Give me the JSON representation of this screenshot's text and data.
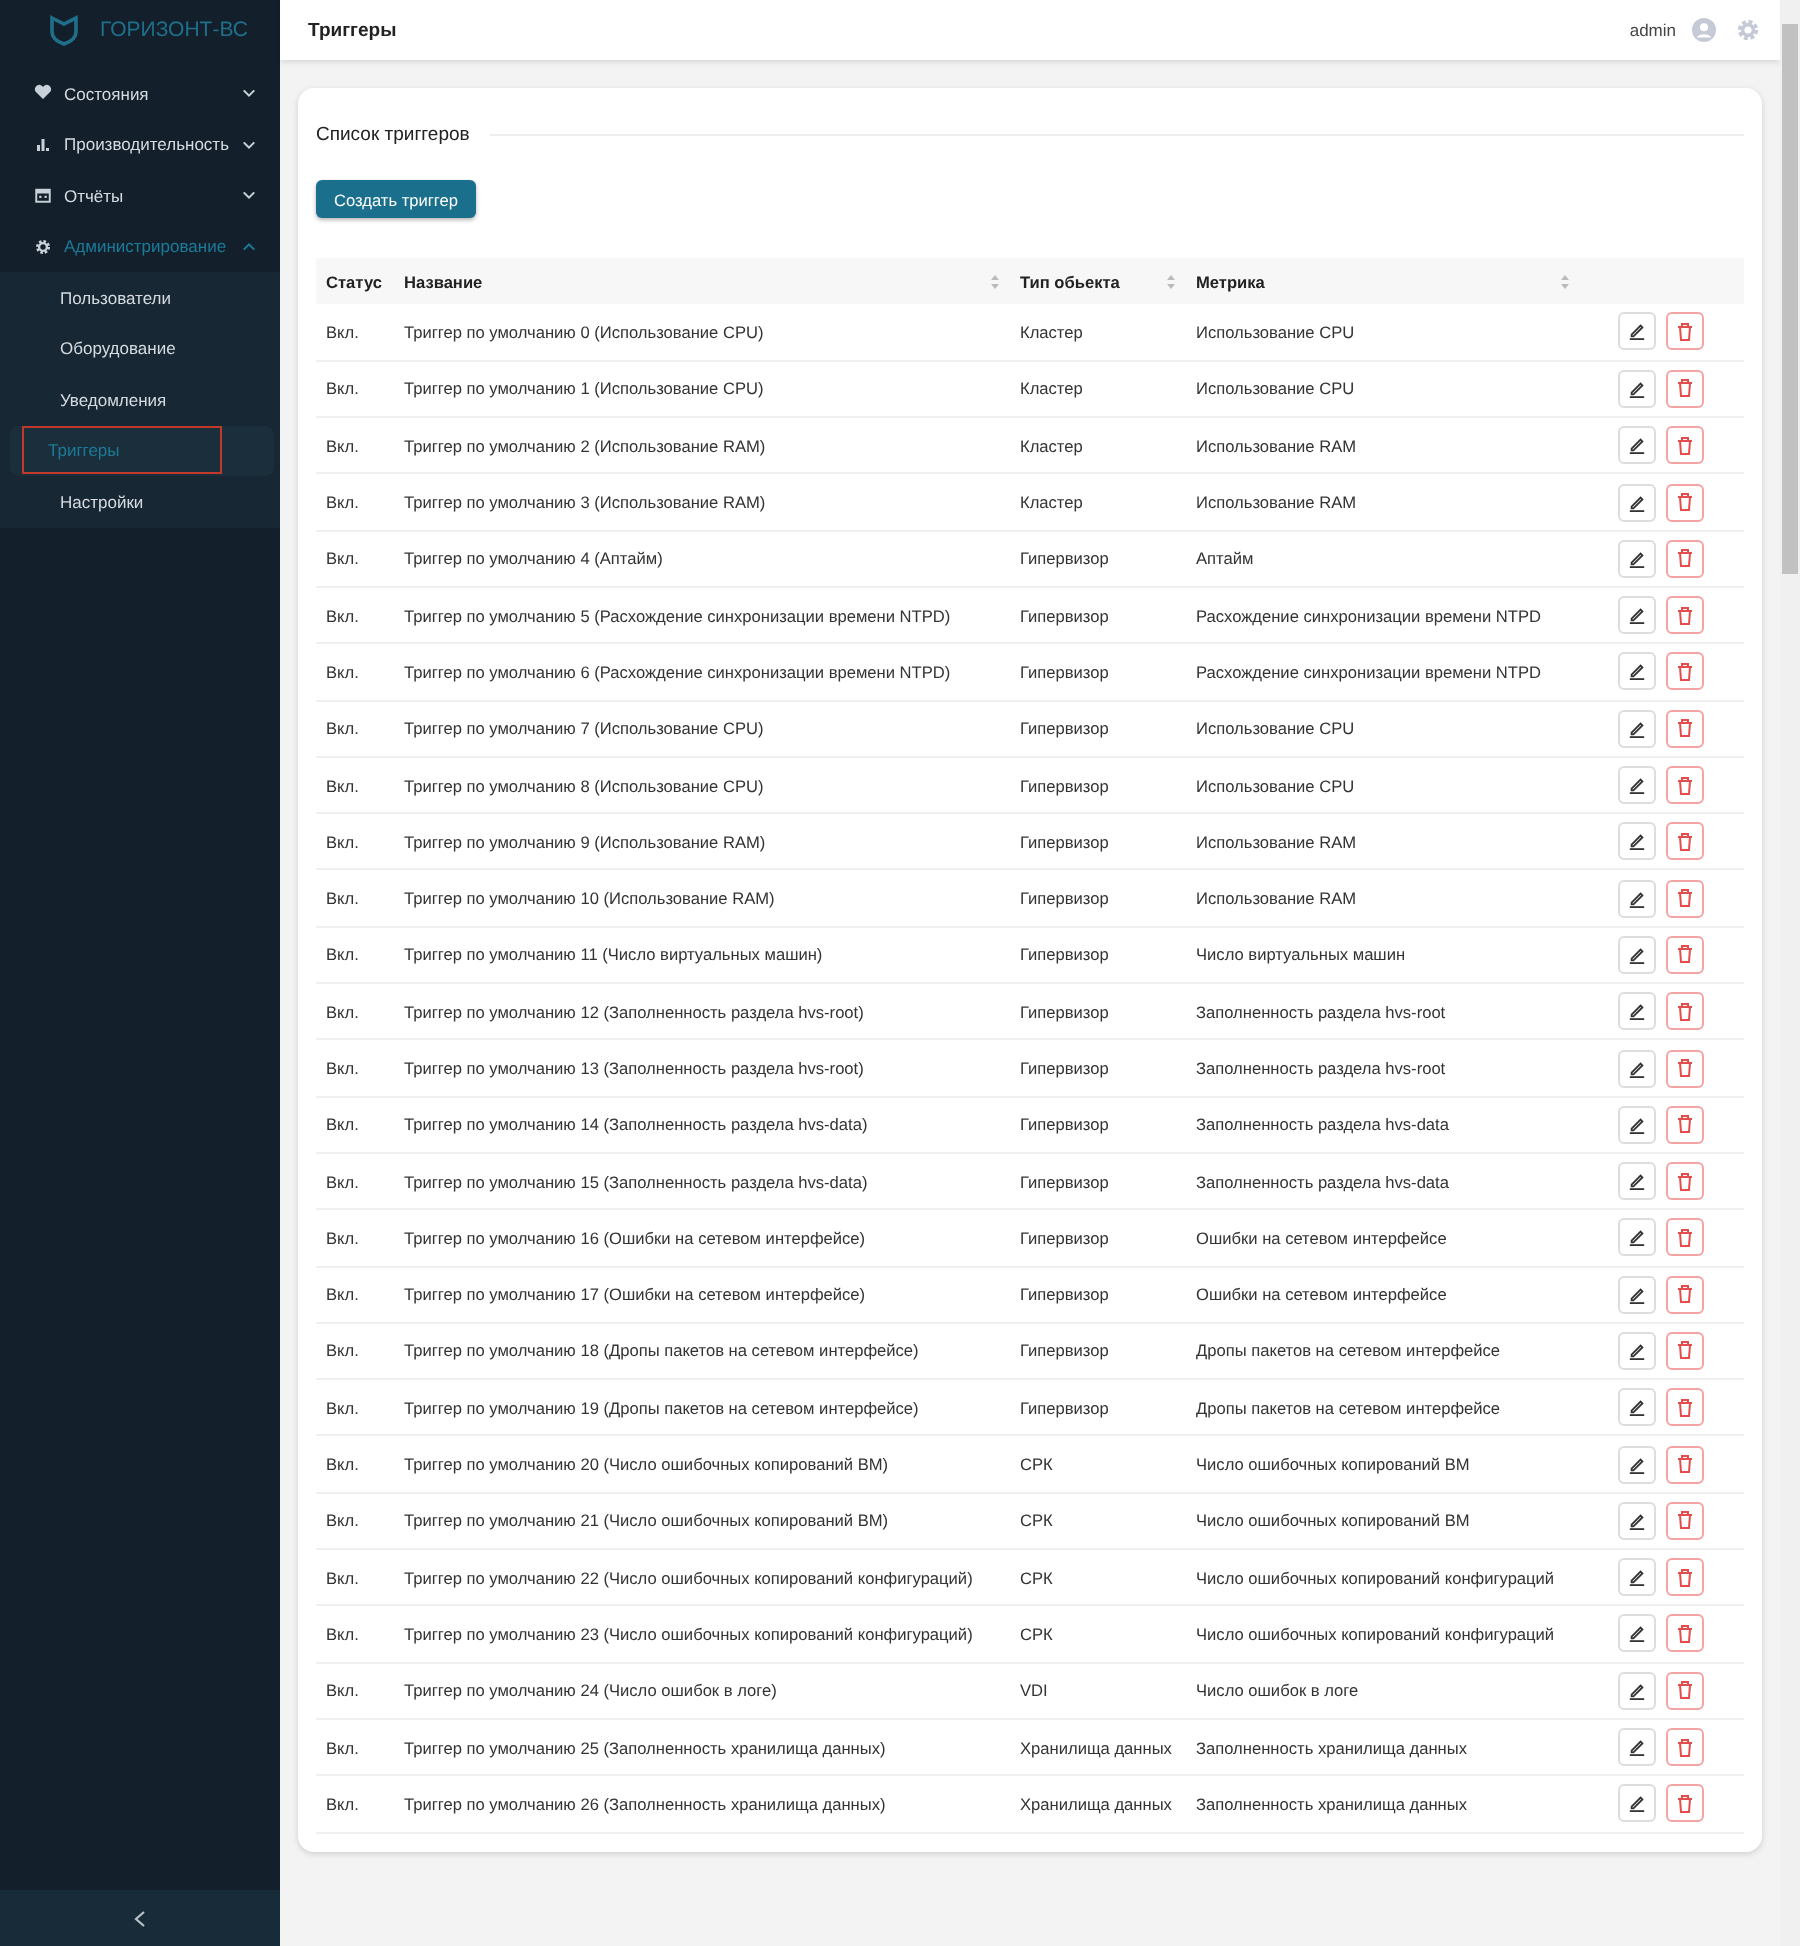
{
  "sidebar": {
    "logo": "ГОРИЗОНТ-ВС",
    "items": [
      {
        "label": "Состояния",
        "expanded": false,
        "selected": false
      },
      {
        "label": "Производительность",
        "expanded": false,
        "selected": false
      },
      {
        "label": "Отчёты",
        "expanded": false,
        "selected": false
      },
      {
        "label": "Администрирование",
        "expanded": true,
        "selected": true,
        "children": [
          {
            "label": "Пользователи",
            "selected": false
          },
          {
            "label": "Оборудование",
            "selected": false
          },
          {
            "label": "Уведомления",
            "selected": false
          },
          {
            "label": "Триггеры",
            "selected": true
          },
          {
            "label": "Настройки",
            "selected": false
          }
        ]
      }
    ]
  },
  "header": {
    "title": "Триггеры",
    "user": "admin"
  },
  "card": {
    "title": "Список триггеров",
    "create_button": "Создать триггер"
  },
  "table": {
    "columns": [
      {
        "label": "Статус",
        "sortable": false
      },
      {
        "label": "Название",
        "sortable": true
      },
      {
        "label": "Тип обьекта",
        "sortable": true
      },
      {
        "label": "Метрика",
        "sortable": true
      }
    ],
    "rows": [
      {
        "status": "Вкл.",
        "name": "Триггер по умолчанию 0 (Использование CPU)",
        "object_type": "Кластер",
        "metric": "Использование CPU"
      },
      {
        "status": "Вкл.",
        "name": "Триггер по умолчанию 1 (Использование CPU)",
        "object_type": "Кластер",
        "metric": "Использование CPU"
      },
      {
        "status": "Вкл.",
        "name": "Триггер по умолчанию 2 (Использование RAM)",
        "object_type": "Кластер",
        "metric": "Использование RAM"
      },
      {
        "status": "Вкл.",
        "name": "Триггер по умолчанию 3 (Использование RAM)",
        "object_type": "Кластер",
        "metric": "Использование RAM"
      },
      {
        "status": "Вкл.",
        "name": "Триггер по умолчанию 4 (Аптайм)",
        "object_type": "Гипервизор",
        "metric": "Аптайм"
      },
      {
        "status": "Вкл.",
        "name": "Триггер по умолчанию 5 (Расхождение синхронизации времени NTPD)",
        "object_type": "Гипервизор",
        "metric": "Расхождение синхронизации времени NTPD"
      },
      {
        "status": "Вкл.",
        "name": "Триггер по умолчанию 6 (Расхождение синхронизации времени NTPD)",
        "object_type": "Гипервизор",
        "metric": "Расхождение синхронизации времени NTPD"
      },
      {
        "status": "Вкл.",
        "name": "Триггер по умолчанию 7 (Использование CPU)",
        "object_type": "Гипервизор",
        "metric": "Использование CPU"
      },
      {
        "status": "Вкл.",
        "name": "Триггер по умолчанию 8 (Использование CPU)",
        "object_type": "Гипервизор",
        "metric": "Использование CPU"
      },
      {
        "status": "Вкл.",
        "name": "Триггер по умолчанию 9 (Использование RAM)",
        "object_type": "Гипервизор",
        "metric": "Использование RAM"
      },
      {
        "status": "Вкл.",
        "name": "Триггер по умолчанию 10 (Использование RAM)",
        "object_type": "Гипервизор",
        "metric": "Использование RAM"
      },
      {
        "status": "Вкл.",
        "name": "Триггер по умолчанию 11 (Число виртуальных машин)",
        "object_type": "Гипервизор",
        "metric": "Число виртуальных машин"
      },
      {
        "status": "Вкл.",
        "name": "Триггер по умолчанию 12 (Заполненность раздела hvs-root)",
        "object_type": "Гипервизор",
        "metric": "Заполненность раздела hvs-root"
      },
      {
        "status": "Вкл.",
        "name": "Триггер по умолчанию 13 (Заполненность раздела hvs-root)",
        "object_type": "Гипервизор",
        "metric": "Заполненность раздела hvs-root"
      },
      {
        "status": "Вкл.",
        "name": "Триггер по умолчанию 14 (Заполненность раздела hvs-data)",
        "object_type": "Гипервизор",
        "metric": "Заполненность раздела hvs-data"
      },
      {
        "status": "Вкл.",
        "name": "Триггер по умолчанию 15 (Заполненность раздела hvs-data)",
        "object_type": "Гипервизор",
        "metric": "Заполненность раздела hvs-data"
      },
      {
        "status": "Вкл.",
        "name": "Триггер по умолчанию 16 (Ошибки на сетевом интерфейсе)",
        "object_type": "Гипервизор",
        "metric": "Ошибки на сетевом интерфейсе"
      },
      {
        "status": "Вкл.",
        "name": "Триггер по умолчанию 17 (Ошибки на сетевом интерфейсе)",
        "object_type": "Гипервизор",
        "metric": "Ошибки на сетевом интерфейсе"
      },
      {
        "status": "Вкл.",
        "name": "Триггер по умолчанию 18 (Дропы пакетов на сетевом интерфейсе)",
        "object_type": "Гипервизор",
        "metric": "Дропы пакетов на сетевом интерфейсе"
      },
      {
        "status": "Вкл.",
        "name": "Триггер по умолчанию 19 (Дропы пакетов на сетевом интерфейсе)",
        "object_type": "Гипервизор",
        "metric": "Дропы пакетов на сетевом интерфейсе"
      },
      {
        "status": "Вкл.",
        "name": "Триггер по умолчанию 20 (Число ошибочных копирований ВМ)",
        "object_type": "СРК",
        "metric": "Число ошибочных копирований ВМ"
      },
      {
        "status": "Вкл.",
        "name": "Триггер по умолчанию 21 (Число ошибочных копирований ВМ)",
        "object_type": "СРК",
        "metric": "Число ошибочных копирований ВМ"
      },
      {
        "status": "Вкл.",
        "name": "Триггер по умолчанию 22 (Число ошибочных копирований конфигураций)",
        "object_type": "СРК",
        "metric": "Число ошибочных копирований конфигураций"
      },
      {
        "status": "Вкл.",
        "name": "Триггер по умолчанию 23 (Число ошибочных копирований конфигураций)",
        "object_type": "СРК",
        "metric": "Число ошибочных копирований конфигураций"
      },
      {
        "status": "Вкл.",
        "name": "Триггер по умолчанию 24 (Число ошибок в логе)",
        "object_type": "VDI",
        "metric": "Число ошибок в логе"
      },
      {
        "status": "Вкл.",
        "name": "Триггер по умолчанию 25 (Заполненность хранилища данных)",
        "object_type": "Хранилища данных",
        "metric": "Заполненность хранилища данных"
      },
      {
        "status": "Вкл.",
        "name": "Триггер по умолчанию 26 (Заполненность хранилища данных)",
        "object_type": "Хранилища данных",
        "metric": "Заполненность хранилища данных"
      }
    ]
  }
}
